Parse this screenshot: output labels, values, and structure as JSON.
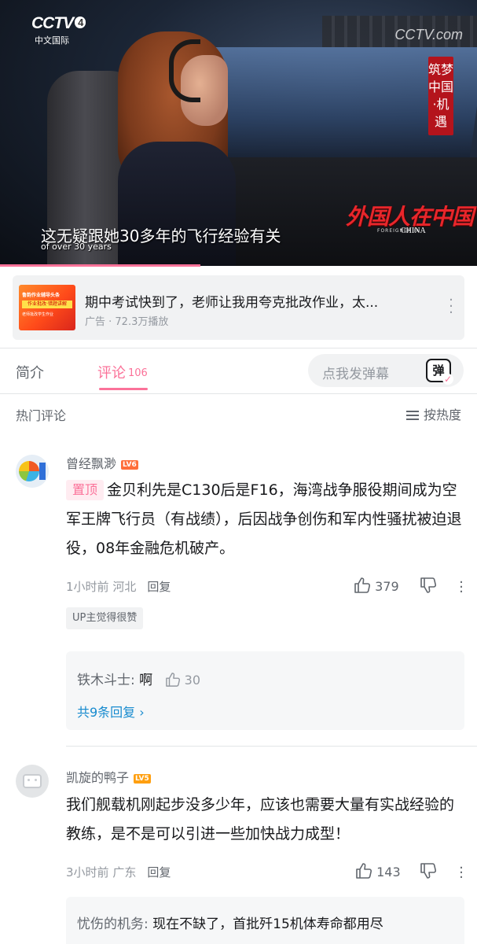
{
  "video": {
    "channel_logo": "CCTV",
    "channel_num": "4",
    "channel_sub": "中文国际",
    "watermark": "CCTV.com",
    "program_title": "筑梦中国·机遇",
    "show_title": "外国人在中国",
    "show_sub": "FOREIGNER IN",
    "show_china": "CHINA",
    "subtitle_cn": "这无疑跟她30多年的飞行经验有关",
    "subtitle_en": "of over 30 years",
    "progress": 0.42
  },
  "ad": {
    "thumb_line1": "鲁韵作业辅导头条",
    "thumb_line2": "作业批改·错题讲解",
    "thumb_line3": "老师批改学生作业",
    "title": "期中考试快到了，老师让我用夸克批改作业，太...",
    "meta": "广告 · 72.3万播放",
    "more_icon": "more-vertical-icon"
  },
  "tabs": {
    "intro": "简介",
    "comments": "评论",
    "comments_count": "106",
    "danmaku_placeholder": "点我发弹幕",
    "danmaku_icon": "弹"
  },
  "section": {
    "hot_label": "热门评论",
    "sort_label": "按热度"
  },
  "comments": [
    {
      "user": "曾经飘渺",
      "level": "LV6",
      "pinned_label": "置顶",
      "text": "金贝利先是C130后是F16，海湾战争服役期间成为空军王牌飞行员（有战绩），后因战争创伤和军内性骚扰被迫退役，08年金融危机破产。",
      "time": "1小时前",
      "location": "河北",
      "reply_label": "回复",
      "likes": "379",
      "up_badge": "UP主觉得很赞",
      "replies": [
        {
          "user": "铁木斗士:",
          "text": "啊",
          "likes": "30"
        }
      ],
      "all_replies": "共9条回复 ›"
    },
    {
      "user": "凯旋的鸭子",
      "level": "LV5",
      "text": "我们舰载机刚起步没多少年，应该也需要大量有实战经验的教练，是不是可以引进一些加快战力成型！",
      "time": "3小时前",
      "location": "广东",
      "reply_label": "回复",
      "likes": "143",
      "replies": [
        {
          "user": "忧伤的机务:",
          "text": "现在不缺了，首批歼15机体寿命都用尽"
        }
      ]
    }
  ],
  "colors": {
    "accent": "#fb7299",
    "link": "#178bcf",
    "muted": "#9499a0"
  }
}
